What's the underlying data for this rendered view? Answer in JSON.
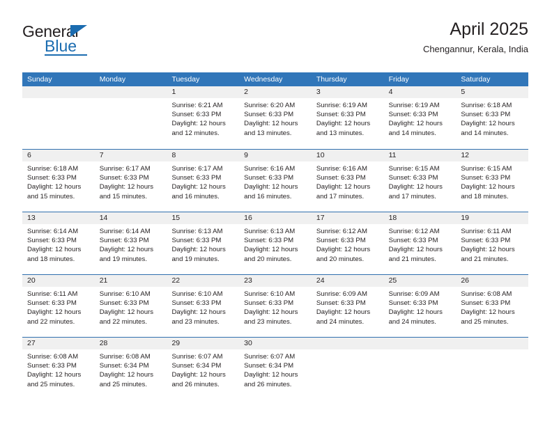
{
  "brand": {
    "name_top": "General",
    "name_bottom": "Blue",
    "triangle_icon": "triangle-icon",
    "accent_color": "#1b6cb0"
  },
  "header": {
    "title": "April 2025",
    "subtitle": "Chengannur, Kerala, India"
  },
  "calendar": {
    "header_bg": "#3176b9",
    "row_border_color": "#2f6fae",
    "day_strip_bg": "#f0f0f0",
    "weekdays": [
      "Sunday",
      "Monday",
      "Tuesday",
      "Wednesday",
      "Thursday",
      "Friday",
      "Saturday"
    ],
    "labels": {
      "sunrise": "Sunrise:",
      "sunset": "Sunset:",
      "daylight": "Daylight:"
    },
    "weeks": [
      [
        {
          "day": ""
        },
        {
          "day": ""
        },
        {
          "day": "1",
          "sunrise": "Sunrise: 6:21 AM",
          "sunset": "Sunset: 6:33 PM",
          "daylight": "Daylight: 12 hours and 12 minutes."
        },
        {
          "day": "2",
          "sunrise": "Sunrise: 6:20 AM",
          "sunset": "Sunset: 6:33 PM",
          "daylight": "Daylight: 12 hours and 13 minutes."
        },
        {
          "day": "3",
          "sunrise": "Sunrise: 6:19 AM",
          "sunset": "Sunset: 6:33 PM",
          "daylight": "Daylight: 12 hours and 13 minutes."
        },
        {
          "day": "4",
          "sunrise": "Sunrise: 6:19 AM",
          "sunset": "Sunset: 6:33 PM",
          "daylight": "Daylight: 12 hours and 14 minutes."
        },
        {
          "day": "5",
          "sunrise": "Sunrise: 6:18 AM",
          "sunset": "Sunset: 6:33 PM",
          "daylight": "Daylight: 12 hours and 14 minutes."
        }
      ],
      [
        {
          "day": "6",
          "sunrise": "Sunrise: 6:18 AM",
          "sunset": "Sunset: 6:33 PM",
          "daylight": "Daylight: 12 hours and 15 minutes."
        },
        {
          "day": "7",
          "sunrise": "Sunrise: 6:17 AM",
          "sunset": "Sunset: 6:33 PM",
          "daylight": "Daylight: 12 hours and 15 minutes."
        },
        {
          "day": "8",
          "sunrise": "Sunrise: 6:17 AM",
          "sunset": "Sunset: 6:33 PM",
          "daylight": "Daylight: 12 hours and 16 minutes."
        },
        {
          "day": "9",
          "sunrise": "Sunrise: 6:16 AM",
          "sunset": "Sunset: 6:33 PM",
          "daylight": "Daylight: 12 hours and 16 minutes."
        },
        {
          "day": "10",
          "sunrise": "Sunrise: 6:16 AM",
          "sunset": "Sunset: 6:33 PM",
          "daylight": "Daylight: 12 hours and 17 minutes."
        },
        {
          "day": "11",
          "sunrise": "Sunrise: 6:15 AM",
          "sunset": "Sunset: 6:33 PM",
          "daylight": "Daylight: 12 hours and 17 minutes."
        },
        {
          "day": "12",
          "sunrise": "Sunrise: 6:15 AM",
          "sunset": "Sunset: 6:33 PM",
          "daylight": "Daylight: 12 hours and 18 minutes."
        }
      ],
      [
        {
          "day": "13",
          "sunrise": "Sunrise: 6:14 AM",
          "sunset": "Sunset: 6:33 PM",
          "daylight": "Daylight: 12 hours and 18 minutes."
        },
        {
          "day": "14",
          "sunrise": "Sunrise: 6:14 AM",
          "sunset": "Sunset: 6:33 PM",
          "daylight": "Daylight: 12 hours and 19 minutes."
        },
        {
          "day": "15",
          "sunrise": "Sunrise: 6:13 AM",
          "sunset": "Sunset: 6:33 PM",
          "daylight": "Daylight: 12 hours and 19 minutes."
        },
        {
          "day": "16",
          "sunrise": "Sunrise: 6:13 AM",
          "sunset": "Sunset: 6:33 PM",
          "daylight": "Daylight: 12 hours and 20 minutes."
        },
        {
          "day": "17",
          "sunrise": "Sunrise: 6:12 AM",
          "sunset": "Sunset: 6:33 PM",
          "daylight": "Daylight: 12 hours and 20 minutes."
        },
        {
          "day": "18",
          "sunrise": "Sunrise: 6:12 AM",
          "sunset": "Sunset: 6:33 PM",
          "daylight": "Daylight: 12 hours and 21 minutes."
        },
        {
          "day": "19",
          "sunrise": "Sunrise: 6:11 AM",
          "sunset": "Sunset: 6:33 PM",
          "daylight": "Daylight: 12 hours and 21 minutes."
        }
      ],
      [
        {
          "day": "20",
          "sunrise": "Sunrise: 6:11 AM",
          "sunset": "Sunset: 6:33 PM",
          "daylight": "Daylight: 12 hours and 22 minutes."
        },
        {
          "day": "21",
          "sunrise": "Sunrise: 6:10 AM",
          "sunset": "Sunset: 6:33 PM",
          "daylight": "Daylight: 12 hours and 22 minutes."
        },
        {
          "day": "22",
          "sunrise": "Sunrise: 6:10 AM",
          "sunset": "Sunset: 6:33 PM",
          "daylight": "Daylight: 12 hours and 23 minutes."
        },
        {
          "day": "23",
          "sunrise": "Sunrise: 6:10 AM",
          "sunset": "Sunset: 6:33 PM",
          "daylight": "Daylight: 12 hours and 23 minutes."
        },
        {
          "day": "24",
          "sunrise": "Sunrise: 6:09 AM",
          "sunset": "Sunset: 6:33 PM",
          "daylight": "Daylight: 12 hours and 24 minutes."
        },
        {
          "day": "25",
          "sunrise": "Sunrise: 6:09 AM",
          "sunset": "Sunset: 6:33 PM",
          "daylight": "Daylight: 12 hours and 24 minutes."
        },
        {
          "day": "26",
          "sunrise": "Sunrise: 6:08 AM",
          "sunset": "Sunset: 6:33 PM",
          "daylight": "Daylight: 12 hours and 25 minutes."
        }
      ],
      [
        {
          "day": "27",
          "sunrise": "Sunrise: 6:08 AM",
          "sunset": "Sunset: 6:33 PM",
          "daylight": "Daylight: 12 hours and 25 minutes."
        },
        {
          "day": "28",
          "sunrise": "Sunrise: 6:08 AM",
          "sunset": "Sunset: 6:34 PM",
          "daylight": "Daylight: 12 hours and 25 minutes."
        },
        {
          "day": "29",
          "sunrise": "Sunrise: 6:07 AM",
          "sunset": "Sunset: 6:34 PM",
          "daylight": "Daylight: 12 hours and 26 minutes."
        },
        {
          "day": "30",
          "sunrise": "Sunrise: 6:07 AM",
          "sunset": "Sunset: 6:34 PM",
          "daylight": "Daylight: 12 hours and 26 minutes."
        },
        {
          "day": ""
        },
        {
          "day": ""
        },
        {
          "day": ""
        }
      ]
    ]
  }
}
